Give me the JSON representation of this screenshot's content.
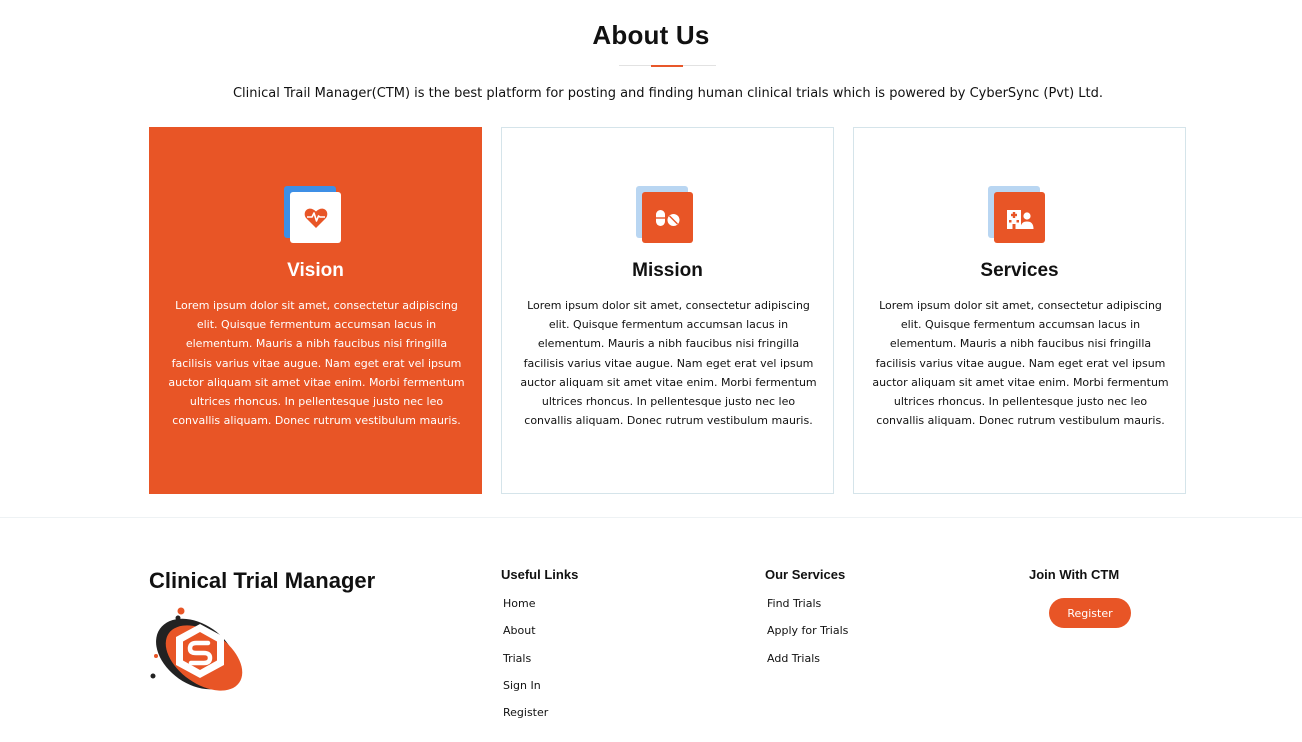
{
  "about": {
    "title": "About Us",
    "intro": "Clinical Trail Manager(CTM) is the best platform for posting and finding human clinical trials which is powered by CyberSync (Pvt) Ltd.",
    "cards": [
      {
        "title": "Vision",
        "icon": "heartbeat-icon",
        "text": "Lorem ipsum dolor sit amet, consectetur adipiscing elit. Quisque fermentum accumsan lacus in elementum. Mauris a nibh faucibus nisi fringilla facilisis varius vitae augue. Nam eget erat vel ipsum auctor aliquam sit amet vitae enim. Morbi fermentum ultrices rhoncus. In pellentesque justo nec leo convallis aliquam. Donec rutrum vestibulum mauris."
      },
      {
        "title": "Mission",
        "icon": "pills-icon",
        "text": "Lorem ipsum dolor sit amet, consectetur adipiscing elit. Quisque fermentum accumsan lacus in elementum. Mauris a nibh faucibus nisi fringilla facilisis varius vitae augue. Nam eget erat vel ipsum auctor aliquam sit amet vitae enim. Morbi fermentum ultrices rhoncus. In pellentesque justo nec leo convallis aliquam. Donec rutrum vestibulum mauris."
      },
      {
        "title": "Services",
        "icon": "hospital-user-icon",
        "text": "Lorem ipsum dolor sit amet, consectetur adipiscing elit. Quisque fermentum accumsan lacus in elementum. Mauris a nibh faucibus nisi fringilla facilisis varius vitae augue. Nam eget erat vel ipsum auctor aliquam sit amet vitae enim. Morbi fermentum ultrices rhoncus. In pellentesque justo nec leo convallis aliquam. Donec rutrum vestibulum mauris."
      }
    ]
  },
  "footer": {
    "brand": "Clinical Trial Manager",
    "useful_links": {
      "heading": "Useful Links",
      "items": [
        "Home",
        "About",
        "Trials",
        "Sign In",
        "Register"
      ]
    },
    "services": {
      "heading": "Our Services",
      "items": [
        "Find Trials",
        "Apply for Trials",
        "Add Trials"
      ]
    },
    "join": {
      "heading": "Join With CTM",
      "button": "Register"
    }
  },
  "colors": {
    "accent": "#e85526",
    "icon_back_active": "#3d8fe6",
    "icon_back": "#b9d6f2"
  }
}
